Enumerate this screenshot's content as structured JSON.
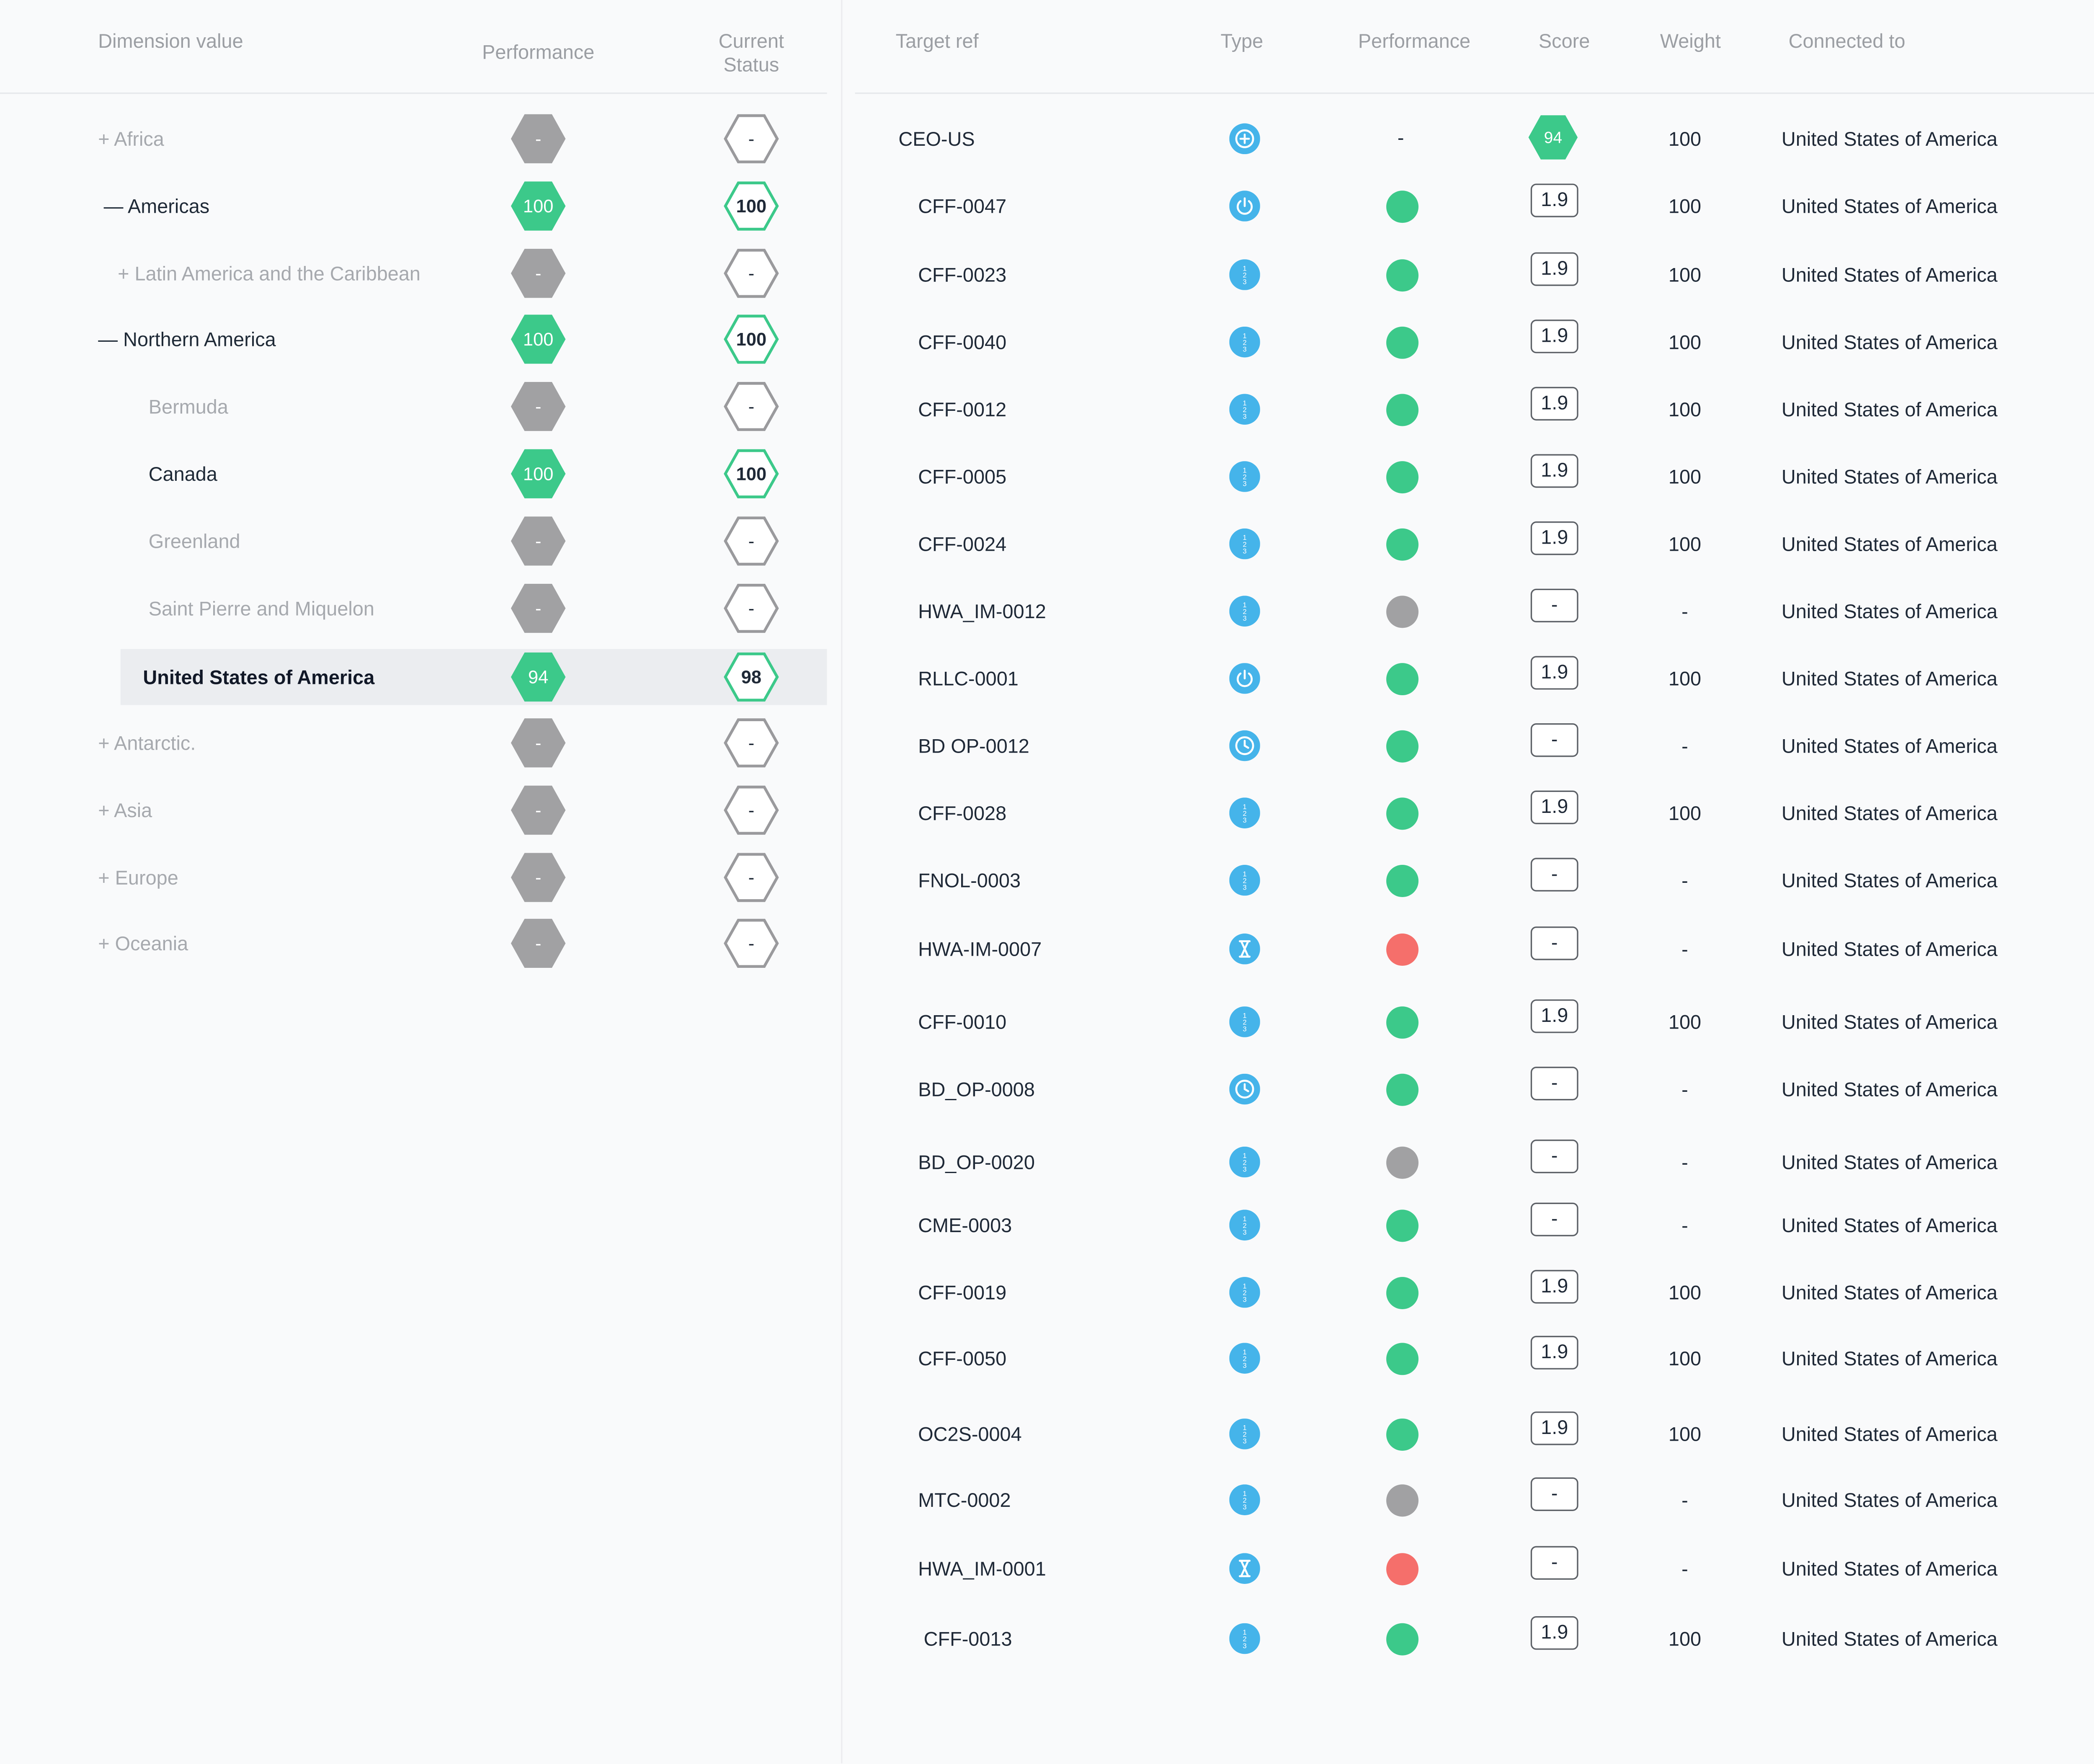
{
  "colors": {
    "green": "#3cc98a",
    "gray": "#a1a1a3",
    "red": "#f56f6b",
    "blue": "#45b4ea",
    "hex_outline_gray": "#9a9a9d",
    "hex_outline_green": "#3cc98a"
  },
  "left_table": {
    "headers": {
      "dimension": "Dimension value",
      "performance": "Performance",
      "status_line1": "Current",
      "status_line2": "Status"
    },
    "rows": [
      {
        "label": "+ Africa",
        "style": "muted",
        "indent": 70,
        "perf": "-",
        "perf_color": "gray",
        "status": "-",
        "status_color": "gray"
      },
      {
        "label": "— Americas",
        "style": "active",
        "indent": 74,
        "perf": "100",
        "perf_color": "green",
        "status": "100",
        "status_color": "green"
      },
      {
        "label": "+ Latin America and the Caribbean",
        "style": "muted",
        "indent": 84,
        "perf": "-",
        "perf_color": "gray",
        "status": "-",
        "status_color": "gray"
      },
      {
        "label": "— Northern America",
        "style": "active",
        "indent": 70,
        "perf": "100",
        "perf_color": "green",
        "status": "100",
        "status_color": "green"
      },
      {
        "label": "Bermuda",
        "style": "muted",
        "indent": 106,
        "perf": "-",
        "perf_color": "gray",
        "status": "-",
        "status_color": "gray"
      },
      {
        "label": "Canada",
        "style": "active",
        "indent": 106,
        "perf": "100",
        "perf_color": "green",
        "status": "100",
        "status_color": "green"
      },
      {
        "label": "Greenland",
        "style": "muted",
        "indent": 106,
        "perf": "-",
        "perf_color": "gray",
        "status": "-",
        "status_color": "gray"
      },
      {
        "label": "Saint Pierre and Miquelon",
        "style": "muted",
        "indent": 106,
        "perf": "-",
        "perf_color": "gray",
        "status": "-",
        "status_color": "gray"
      },
      {
        "label": "United States of America",
        "style": "strong",
        "indent": 102,
        "selected": true,
        "perf": "94",
        "perf_color": "green",
        "status": "98",
        "status_color": "green"
      },
      {
        "label": "+ Antarctic.",
        "style": "muted",
        "indent": 70,
        "perf": "-",
        "perf_color": "gray",
        "status": "-",
        "status_color": "gray"
      },
      {
        "label": "+ Asia",
        "style": "muted",
        "indent": 70,
        "perf": "-",
        "perf_color": "gray",
        "status": "-",
        "status_color": "gray"
      },
      {
        "label": "+ Europe",
        "style": "muted",
        "indent": 70,
        "perf": "-",
        "perf_color": "gray",
        "status": "-",
        "status_color": "gray"
      },
      {
        "label": "+ Oceania",
        "style": "muted",
        "indent": 70,
        "perf": "-",
        "perf_color": "gray",
        "status": "-",
        "status_color": "gray"
      }
    ]
  },
  "right_table": {
    "headers": {
      "target_ref": "Target ref",
      "type": "Type",
      "performance": "Performance",
      "score": "Score",
      "weight": "Weight",
      "connected_to": "Connected to"
    },
    "rows": [
      {
        "ref": "CEO-US",
        "ref_indent": 40,
        "type_icon": "plus-circle-icon",
        "performance": "-",
        "score": "94",
        "score_style": "hex",
        "weight": "100",
        "connected": "United States of America"
      },
      {
        "ref": "CFF-0047",
        "ref_indent": 54,
        "type_icon": "power-icon",
        "performance": "green",
        "score": "1.9",
        "weight": "100",
        "connected": "United States of America"
      },
      {
        "ref": "CFF-0023",
        "ref_indent": 54,
        "type_icon": "ordinal-icon",
        "performance": "green",
        "score": "1.9",
        "weight": "100",
        "connected": "United States of America"
      },
      {
        "ref": "CFF-0040",
        "ref_indent": 54,
        "type_icon": "ordinal-icon",
        "performance": "green",
        "score": "1.9",
        "weight": "100",
        "connected": "United States of America"
      },
      {
        "ref": "CFF-0012",
        "ref_indent": 54,
        "type_icon": "ordinal-icon",
        "performance": "green",
        "score": "1.9",
        "weight": "100",
        "connected": "United States of America"
      },
      {
        "ref": "CFF-0005",
        "ref_indent": 54,
        "type_icon": "ordinal-icon",
        "performance": "green",
        "score": "1.9",
        "weight": "100",
        "connected": "United States of America"
      },
      {
        "ref": "CFF-0024",
        "ref_indent": 54,
        "type_icon": "ordinal-icon",
        "performance": "green",
        "score": "1.9",
        "weight": "100",
        "connected": "United States of America"
      },
      {
        "ref": "HWA_IM-0012",
        "ref_indent": 54,
        "type_icon": "ordinal-icon",
        "performance": "gray",
        "score": "-",
        "weight": "-",
        "connected": "United States of America"
      },
      {
        "ref": "RLLC-0001",
        "ref_indent": 54,
        "type_icon": "power-icon",
        "performance": "green",
        "score": "1.9",
        "weight": "100",
        "connected": "United States of America"
      },
      {
        "ref": "BD OP-0012",
        "ref_indent": 54,
        "type_icon": "clock-icon",
        "performance": "green",
        "score": "-",
        "weight": "-",
        "connected": "United States of America"
      },
      {
        "ref": "CFF-0028",
        "ref_indent": 54,
        "type_icon": "ordinal-icon",
        "performance": "green",
        "score": "1.9",
        "weight": "100",
        "connected": "United States of America"
      },
      {
        "ref": "FNOL-0003",
        "ref_indent": 54,
        "type_icon": "ordinal-icon",
        "performance": "green",
        "score": "-",
        "weight": "-",
        "connected": "United States of America"
      },
      {
        "ref": "HWA-IM-0007",
        "ref_indent": 54,
        "type_icon": "hourglass-icon",
        "performance": "red",
        "score": "-",
        "weight": "-",
        "connected": "United States of America"
      },
      {
        "ref": "CFF-0010",
        "ref_indent": 54,
        "type_icon": "ordinal-icon",
        "performance": "green",
        "score": "1.9",
        "weight": "100",
        "connected": "United States of America"
      },
      {
        "ref": "BD_OP-0008",
        "ref_indent": 54,
        "type_icon": "clock-icon",
        "performance": "green",
        "score": "-",
        "weight": "-",
        "connected": "United States of America"
      },
      {
        "ref": "BD_OP-0020",
        "ref_indent": 54,
        "type_icon": "ordinal-icon",
        "performance": "gray",
        "score": "-",
        "weight": "-",
        "connected": "United States of America"
      },
      {
        "ref": "CME-0003",
        "ref_indent": 54,
        "type_icon": "ordinal-icon",
        "performance": "green",
        "score": "-",
        "weight": "-",
        "connected": "United States of America"
      },
      {
        "ref": "CFF-0019",
        "ref_indent": 54,
        "type_icon": "ordinal-icon",
        "performance": "green",
        "score": "1.9",
        "weight": "100",
        "connected": "United States of America"
      },
      {
        "ref": "CFF-0050",
        "ref_indent": 54,
        "type_icon": "ordinal-icon",
        "performance": "green",
        "score": "1.9",
        "weight": "100",
        "connected": "United States of America"
      },
      {
        "ref": "OC2S-0004",
        "ref_indent": 54,
        "type_icon": "ordinal-icon",
        "performance": "green",
        "score": "1.9",
        "weight": "100",
        "connected": "United States of America"
      },
      {
        "ref": "MTC-0002",
        "ref_indent": 54,
        "type_icon": "ordinal-icon",
        "performance": "gray",
        "score": "-",
        "weight": "-",
        "connected": "United States of America"
      },
      {
        "ref": "HWA_IM-0001",
        "ref_indent": 54,
        "type_icon": "hourglass-icon",
        "performance": "red",
        "score": "-",
        "weight": "-",
        "connected": "United States of America"
      },
      {
        "ref": "CFF-0013",
        "ref_indent": 58,
        "type_icon": "ordinal-icon",
        "performance": "green",
        "score": "1.9",
        "weight": "100",
        "connected": "United States of America"
      }
    ]
  }
}
